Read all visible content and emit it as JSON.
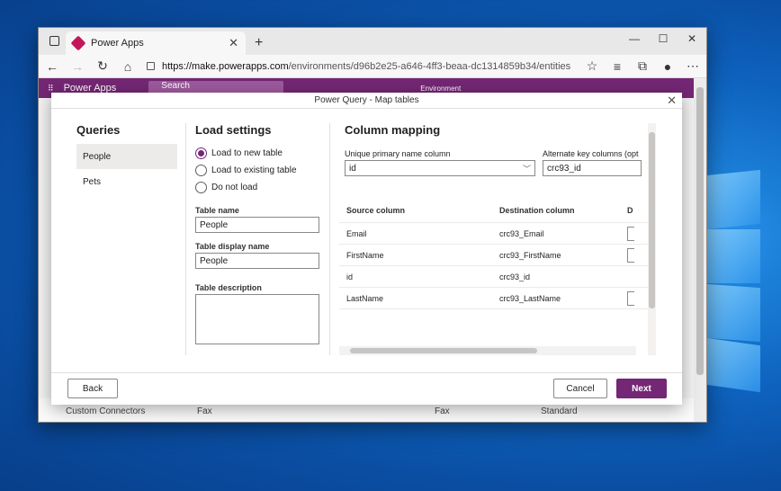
{
  "browser": {
    "tab_title": "Power Apps",
    "url_host": "https://make.powerapps.com",
    "url_path": "/environments/d96b2e25-a646-4ff3-beaa-dc1314859b34/entities",
    "controls": {
      "minimize": "—",
      "maximize": "☐",
      "close": "✕"
    }
  },
  "app": {
    "name": "Power Apps",
    "search_placeholder": "Search",
    "environment_label": "Environment",
    "sidebar_bottom": "Custom Connectors",
    "bottom_row": {
      "col1": "Fax",
      "col2": "Fax",
      "col3": "Standard"
    }
  },
  "dialog": {
    "title": "Power Query - Map tables",
    "queries": {
      "heading": "Queries",
      "items": [
        "People",
        "Pets"
      ]
    },
    "load": {
      "heading": "Load settings",
      "options": [
        "Load to new table",
        "Load to existing table",
        "Do not load"
      ],
      "table_name_label": "Table name",
      "table_name": "People",
      "display_name_label": "Table display name",
      "display_name": "People",
      "description_label": "Table description"
    },
    "mapping": {
      "heading": "Column mapping",
      "primary_label": "Unique primary name column",
      "primary_value": "id",
      "alt_label": "Alternate key columns (opt",
      "alt_value": "crc93_id",
      "headers": [
        "Source column",
        "Destination column",
        "D"
      ],
      "rows": [
        {
          "source": "Email",
          "dest": "crc93_Email"
        },
        {
          "source": "FirstName",
          "dest": "crc93_FirstName"
        },
        {
          "source": "id",
          "dest": "crc93_id"
        },
        {
          "source": "LastName",
          "dest": "crc93_LastName"
        }
      ]
    },
    "footer": {
      "back": "Back",
      "cancel": "Cancel",
      "next": "Next"
    }
  }
}
